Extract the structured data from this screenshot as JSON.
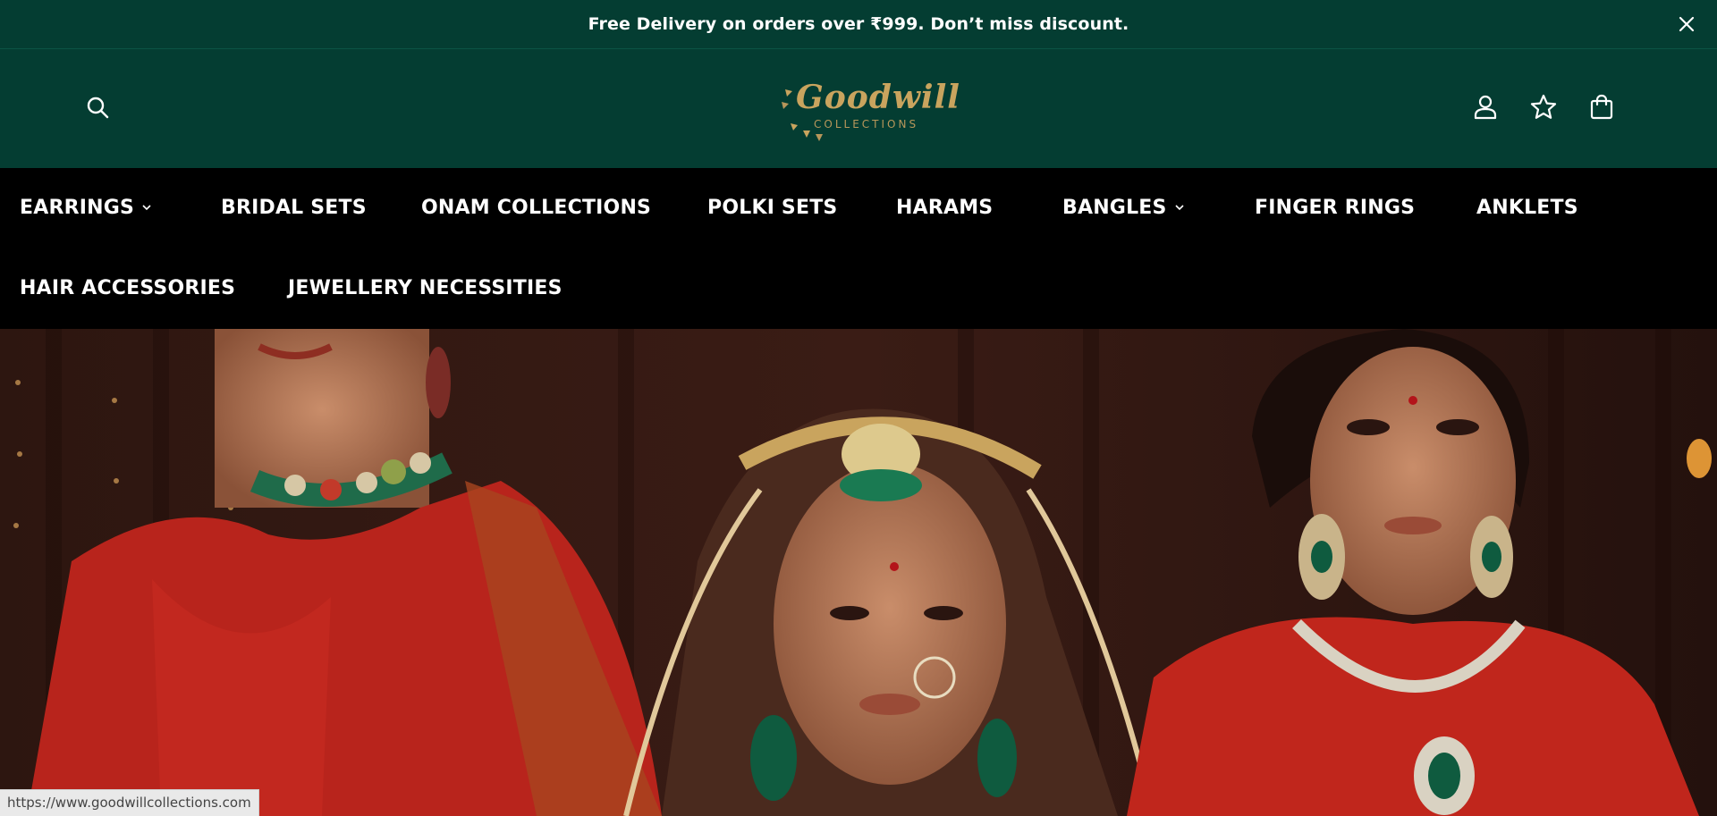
{
  "announcement": {
    "text": "Free Delivery on orders over  ₹999. Don’t miss discount."
  },
  "brand": {
    "name": "Goodwill",
    "tagline": "COLLECTIONS",
    "gold": "#c9a45e",
    "primary_green": "#043d32"
  },
  "header_icons": [
    "search-icon",
    "user-icon",
    "star-icon",
    "shopping-bag-icon"
  ],
  "nav": {
    "items": [
      {
        "label": "EARRINGS",
        "has_dropdown": true
      },
      {
        "label": "BRIDAL SETS",
        "has_dropdown": false
      },
      {
        "label": "ONAM COLLECTIONS",
        "has_dropdown": false
      },
      {
        "label": "POLKI SETS",
        "has_dropdown": false
      },
      {
        "label": "HARAMS",
        "has_dropdown": false
      },
      {
        "label": "BANGLES",
        "has_dropdown": true
      },
      {
        "label": "FINGER RINGS",
        "has_dropdown": false
      },
      {
        "label": "ANKLETS",
        "has_dropdown": false
      },
      {
        "label": "HAIR ACCESSORIES",
        "has_dropdown": false
      },
      {
        "label": "JEWELLERY NECESSITIES",
        "has_dropdown": false
      }
    ]
  },
  "status_bar": {
    "url": "https://www.goodwillcollections.com"
  }
}
